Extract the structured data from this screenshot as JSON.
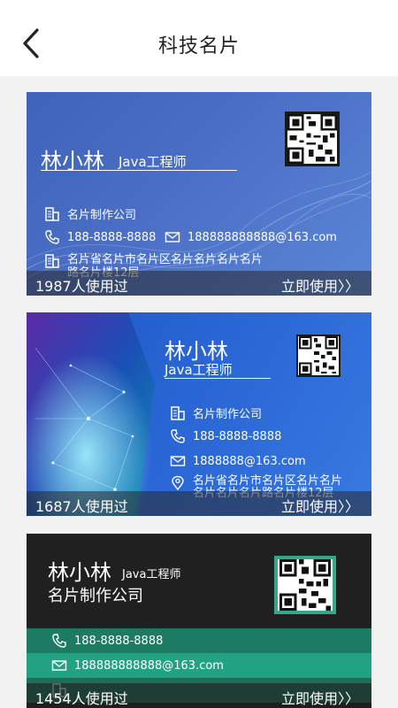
{
  "header": {
    "title": "科技名片"
  },
  "cards": [
    {
      "name": "林小林",
      "role": "Java工程师",
      "company": "名片制作公司",
      "phone": "188-8888-8888",
      "email": "188888888888@163.com",
      "address_line1": "名片省名片市名片区名片名片名片名片",
      "address_line2": "路名片楼12层",
      "uses": "1987人使用过",
      "use_label": "立即使用〉〉"
    },
    {
      "name": "林小林",
      "role": "Java工程师",
      "company": "名片制作公司",
      "phone": "188-8888-8888",
      "email": "1888888@163.com",
      "address_line1": "名片省名片市名片区名片名片",
      "address_line2": "名片名片名片路名片楼12层",
      "uses": "1687人使用过",
      "use_label": "立即使用〉〉"
    },
    {
      "name": "林小林",
      "role": "Java工程师",
      "company": "名片制作公司",
      "phone": "188-8888-8888",
      "email": "188888888888@163.com",
      "uses": "1454人使用过",
      "use_label": "立即使用〉〉"
    }
  ],
  "colors": {
    "card3_green_dark": "#1d7b63",
    "card3_green_light": "#23a283"
  },
  "icons": [
    "back-chevron-icon",
    "building-icon",
    "phone-icon",
    "mail-icon",
    "location-icon",
    "qr-code-icon"
  ]
}
